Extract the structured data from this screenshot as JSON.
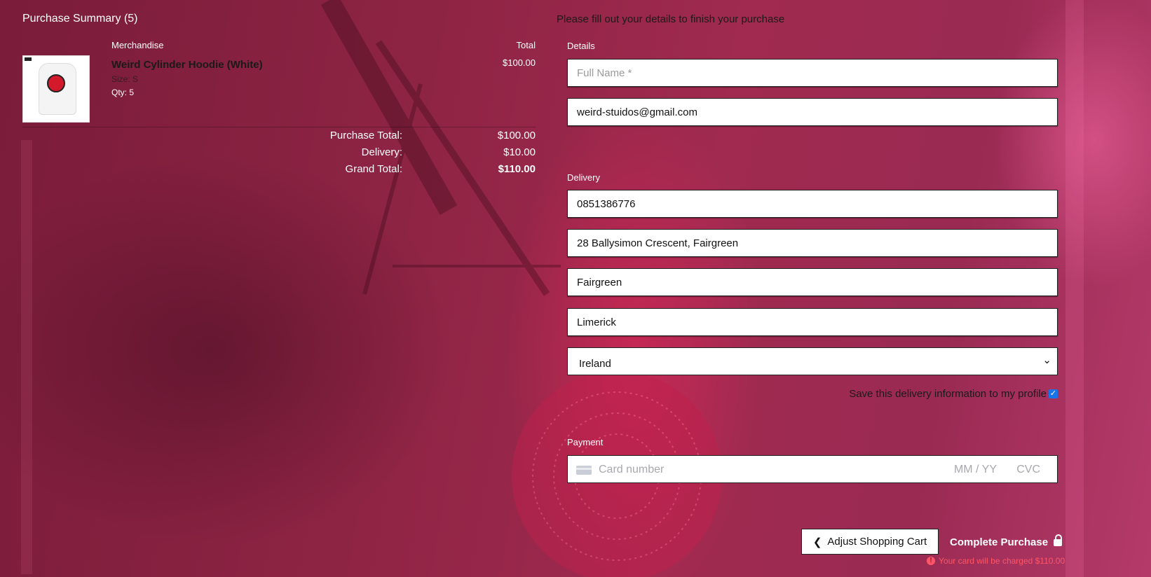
{
  "summary": {
    "title": "Purchase Summary (5)",
    "col_merchandise": "Merchandise",
    "col_total": "Total",
    "item": {
      "name": "Weird Cylinder Hoodie (White)",
      "size": "Size: S",
      "qty": "Qty: 5",
      "price": "$100.00"
    },
    "totals": {
      "purchase_label": "Purchase Total:",
      "purchase_value": "$100.00",
      "delivery_label": "Delivery:",
      "delivery_value": "$10.00",
      "grand_label": "Grand Total:",
      "grand_value": "$110.00"
    }
  },
  "form": {
    "heading": "Please fill out your details to finish your purchase",
    "details_label": "Details",
    "full_name_placeholder": "Full Name *",
    "email_value": "weird-stuidos@gmail.com",
    "delivery_label": "Delivery",
    "phone_value": "0851386776",
    "address_value": "28 Ballysimon Crescent, Fairgreen",
    "town_value": "Fairgreen",
    "county_value": "Limerick",
    "country_value": "Ireland",
    "save_label": "Save this delivery information to my profile",
    "save_checked": true,
    "payment_label": "Payment",
    "card_placeholder": "Card number",
    "card_exp_placeholder": "MM / YY",
    "card_cvc_placeholder": "CVC"
  },
  "actions": {
    "adjust_label": "Adjust Shopping Cart",
    "complete_label": "Complete Purchase",
    "charge_note": "Your card will be charged $110.00"
  },
  "colors": {
    "accent_checkbox": "#1a73e8",
    "warning": "#ff5566"
  }
}
